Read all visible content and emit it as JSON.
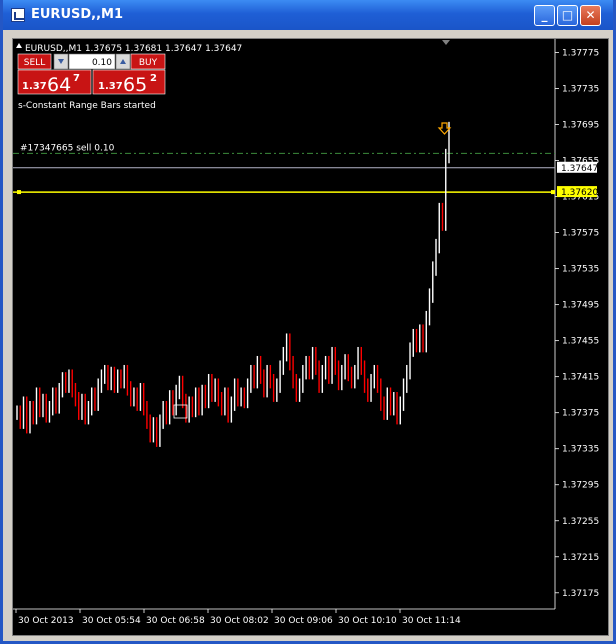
{
  "window": {
    "title": "EURUSD,,M1"
  },
  "chart_header": "EURUSD,,M1  1.37675 1.37681 1.37647 1.37647",
  "one_click": {
    "sell_label": "SELL",
    "buy_label": "BUY",
    "lot": "0.10",
    "sell_price": {
      "prefix": "1.37",
      "big": "64",
      "sup": "7"
    },
    "buy_price": {
      "prefix": "1.37",
      "big": "65",
      "sup": "2"
    }
  },
  "status_text": "s-Constant Range Bars started",
  "order_line_label": "#17347665 sell 0.10",
  "price_labels": {
    "current": "1.37647",
    "yellow_line": "1.37620"
  },
  "colors": {
    "background": "#000000",
    "bull": "#ffffff",
    "bear": "#ff0000",
    "order_line": "#3c8c3c",
    "bid_line": "#b4b4c8",
    "yellow_line": "#ffff00",
    "sell_panel": "#c81414",
    "arrow": "#ffa800"
  },
  "chart_data": {
    "type": "line",
    "y_ticks": [
      "1.37775",
      "1.37735",
      "1.37695",
      "1.37655",
      "1.37615",
      "1.37575",
      "1.37535",
      "1.37495",
      "1.37455",
      "1.37415",
      "1.37375",
      "1.37335",
      "1.37295",
      "1.37255",
      "1.37215",
      "1.37175"
    ],
    "x_ticks": [
      "30 Oct 2013",
      "30 Oct 05:54",
      "30 Oct 06:58",
      "30 Oct 08:02",
      "30 Oct 09:06",
      "30 Oct 10:10",
      "30 Oct 11:14"
    ],
    "ylim": [
      1.37157,
      1.3779
    ],
    "series": [
      {
        "values": [
          1.37375,
          1.37365,
          1.37385,
          1.3736,
          1.3738,
          1.3737,
          1.37395,
          1.37378,
          1.37388,
          1.37372,
          1.3738,
          1.37395,
          1.37382,
          1.374,
          1.37412,
          1.37405,
          1.37415,
          1.374,
          1.3739,
          1.37375,
          1.37388,
          1.3737,
          1.3738,
          1.37395,
          1.37385,
          1.37405,
          1.37415,
          1.3742,
          1.37408,
          1.37418,
          1.37405,
          1.37415,
          1.3741,
          1.3742,
          1.37402,
          1.3739,
          1.37395,
          1.37385,
          1.374,
          1.3738,
          1.37365,
          1.3735,
          1.37362,
          1.37345,
          1.37365,
          1.3738,
          1.3737,
          1.37392,
          1.3738,
          1.37398,
          1.37408,
          1.37388,
          1.37372,
          1.37385,
          1.37378,
          1.37395,
          1.3738,
          1.37398,
          1.37388,
          1.3741,
          1.37395,
          1.37405,
          1.3739,
          1.3738,
          1.37395,
          1.37372,
          1.37385,
          1.37405,
          1.3739,
          1.37395,
          1.37388,
          1.37405,
          1.3742,
          1.3741,
          1.3743,
          1.37415,
          1.374,
          1.3742,
          1.3741,
          1.37395,
          1.37405,
          1.37425,
          1.3744,
          1.37455,
          1.3743,
          1.3741,
          1.37395,
          1.37405,
          1.3742,
          1.3743,
          1.3742,
          1.3744,
          1.37425,
          1.37405,
          1.3742,
          1.3743,
          1.37415,
          1.3744,
          1.37425,
          1.37408,
          1.3742,
          1.37432,
          1.37418,
          1.3741,
          1.3742,
          1.3744,
          1.37425,
          1.37405,
          1.37395,
          1.3741,
          1.3742,
          1.37405,
          1.37385,
          1.37375,
          1.37395,
          1.3738,
          1.3739,
          1.3737,
          1.37385,
          1.37405,
          1.3742,
          1.37445,
          1.3746,
          1.3745,
          1.37465,
          1.3745,
          1.3748,
          1.37505,
          1.37535,
          1.3756,
          1.376,
          1.37585,
          1.3766,
          1.3769
        ]
      }
    ]
  }
}
